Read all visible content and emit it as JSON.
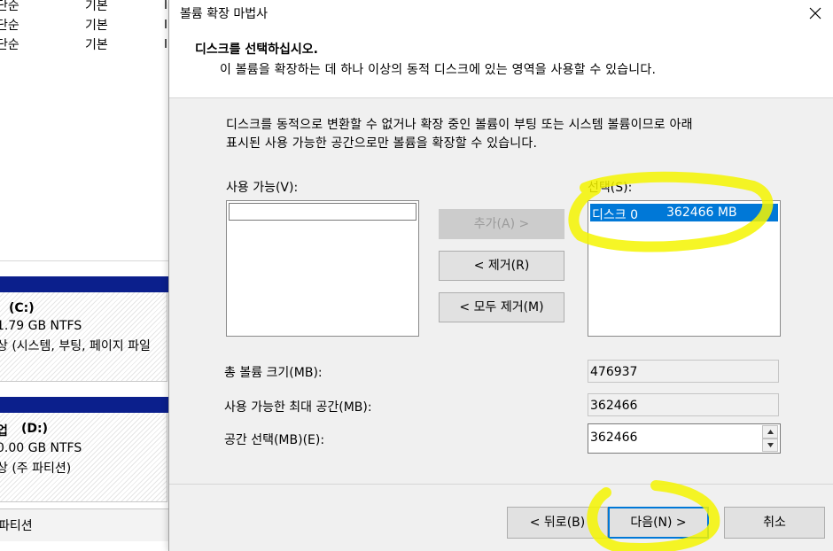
{
  "background": {
    "list_rows": [
      {
        "type": "단순",
        "kind": "기본"
      },
      {
        "type": "단순",
        "kind": "기본"
      },
      {
        "type": "단순",
        "kind": "기본"
      }
    ],
    "volume_c": {
      "name": "(C:)",
      "size": "1.79 GB NTFS",
      "status": "상 (시스템, 부팅, 페이지 파일"
    },
    "volume_d": {
      "name_prefix": "업",
      "name": "(D:)",
      "size": "0.00 GB NTFS",
      "status": "상 (주 파티션)"
    },
    "legend_partition": "파티션"
  },
  "dialog": {
    "title": "볼륨 확장 마법사",
    "header_title": "디스크를 선택하십시오.",
    "header_subtitle": "이 볼륨을 확장하는 데 하나 이상의 동적 디스크에 있는 영역을 사용할 수 있습니다.",
    "description_line1": "디스크를 동적으로 변환할 수 없거나 확장 중인 볼륨이 부팅 또는 시스템 볼륨이므로 아래",
    "description_line2": "표시된 사용 가능한 공간으로만 볼륨을 확장할 수 있습니다.",
    "available_label": "사용 가능(V):",
    "selected_label": "선택(S):",
    "selected_items": [
      {
        "disk": "디스크 0",
        "size": "362466 MB"
      }
    ],
    "buttons": {
      "add": "추가(A) >",
      "remove": "< 제거(R)",
      "remove_all": "< 모두 제거(M)",
      "back": "< 뒤로(B)",
      "next": "다음(N) >",
      "cancel": "취소"
    },
    "total_size_label": "총 볼륨 크기(MB):",
    "total_size_value": "476937",
    "max_space_label": "사용 가능한 최대 공간(MB):",
    "max_space_value": "362466",
    "select_space_label": "공간 선택(MB)(E):",
    "select_space_value": "362466"
  },
  "colors": {
    "selection": "#0078d7",
    "volume_bar": "#0b1f8c",
    "highlighter": "#f5f500"
  }
}
